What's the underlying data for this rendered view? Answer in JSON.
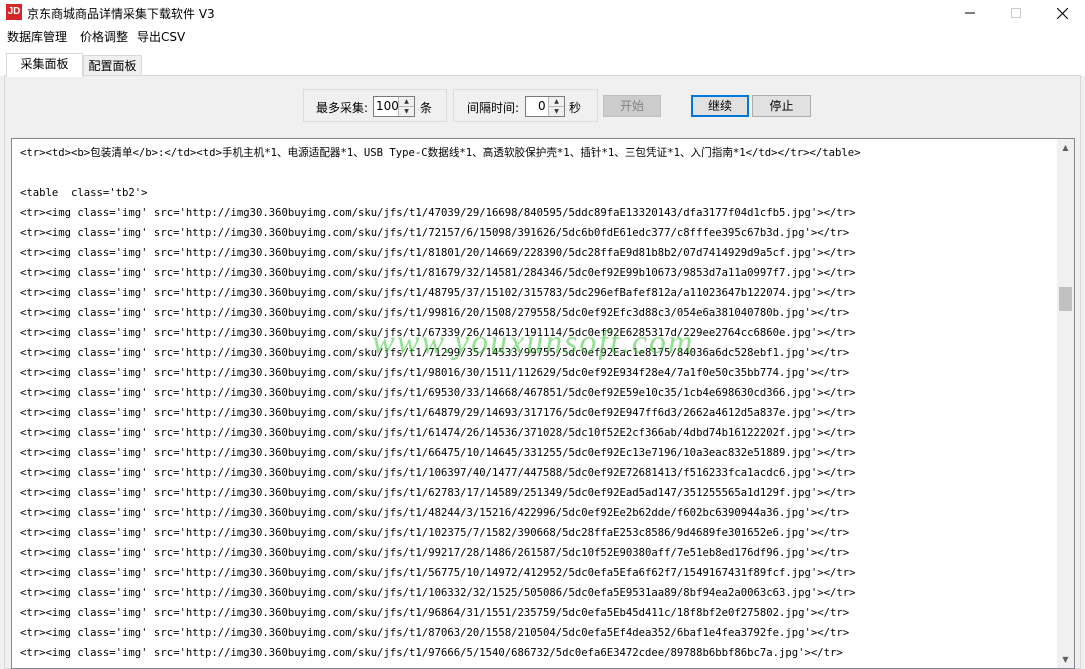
{
  "window": {
    "icon_text": "JD",
    "title": "京东商城商品详情采集下载软件 V3"
  },
  "menu": [
    "数据库管理",
    "价格调整",
    "导出CSV"
  ],
  "tabs": [
    "采集面板",
    "配置面板"
  ],
  "controls": {
    "max_label": "最多采集:",
    "max_value": "100",
    "max_unit": "条",
    "interval_label": "间隔时间:",
    "interval_value": "0",
    "interval_unit": "秒",
    "start_label": "开始",
    "continue_label": "继续",
    "stop_label": "停止"
  },
  "watermark": "www.youxunsoft.com",
  "content_lines": [
    "<tr><td><b>包装清单</b>:</td><td>手机主机*1、电源适配器*1、USB Type-C数据线*1、高透软胶保护壳*1、插针*1、三包凭证*1、入门指南*1</td></tr></table>",
    "",
    "<table  class='tb2'>",
    "<tr><img class='img' src='http://img30.360buyimg.com/sku/jfs/t1/47039/29/16698/840595/5ddc89faE13320143/dfa3177f04d1cfb5.jpg'></tr>",
    "<tr><img class='img' src='http://img30.360buyimg.com/sku/jfs/t1/72157/6/15098/391626/5dc6b0fdE61edc377/c8fffee395c67b3d.jpg'></tr>",
    "<tr><img class='img' src='http://img30.360buyimg.com/sku/jfs/t1/81801/20/14669/228390/5dc28ffaE9d81b8b2/07d7414929d9a5cf.jpg'></tr>",
    "<tr><img class='img' src='http://img30.360buyimg.com/sku/jfs/t1/81679/32/14581/284346/5dc0ef92E99b10673/9853d7a11a0997f7.jpg'></tr>",
    "<tr><img class='img' src='http://img30.360buyimg.com/sku/jfs/t1/48795/37/15102/315783/5dc296efBafef812a/a11023647b122074.jpg'></tr>",
    "<tr><img class='img' src='http://img30.360buyimg.com/sku/jfs/t1/99816/20/1508/279558/5dc0ef92Efc3d88c3/054e6a381040780b.jpg'></tr>",
    "<tr><img class='img' src='http://img30.360buyimg.com/sku/jfs/t1/67339/26/14613/191114/5dc0ef92E6285317d/229ee2764cc6860e.jpg'></tr>",
    "<tr><img class='img' src='http://img30.360buyimg.com/sku/jfs/t1/71299/35/14533/99755/5dc0ef92Eac1e8175/84036a6dc528ebf1.jpg'></tr>",
    "<tr><img class='img' src='http://img30.360buyimg.com/sku/jfs/t1/98016/30/1511/112629/5dc0ef92E934f28e4/7a1f0e50c35bb774.jpg'></tr>",
    "<tr><img class='img' src='http://img30.360buyimg.com/sku/jfs/t1/69530/33/14668/467851/5dc0ef92E59e10c35/1cb4e698630cd366.jpg'></tr>",
    "<tr><img class='img' src='http://img30.360buyimg.com/sku/jfs/t1/64879/29/14693/317176/5dc0ef92E947ff6d3/2662a4612d5a837e.jpg'></tr>",
    "<tr><img class='img' src='http://img30.360buyimg.com/sku/jfs/t1/61474/26/14536/371028/5dc10f52E2cf366ab/4dbd74b16122202f.jpg'></tr>",
    "<tr><img class='img' src='http://img30.360buyimg.com/sku/jfs/t1/66475/10/14645/331255/5dc0ef92Ec13e7196/10a3eac832e51889.jpg'></tr>",
    "<tr><img class='img' src='http://img30.360buyimg.com/sku/jfs/t1/106397/40/1477/447588/5dc0ef92E72681413/f516233fca1acdc6.jpg'></tr>",
    "<tr><img class='img' src='http://img30.360buyimg.com/sku/jfs/t1/62783/17/14589/251349/5dc0ef92Ead5ad147/351255565a1d129f.jpg'></tr>",
    "<tr><img class='img' src='http://img30.360buyimg.com/sku/jfs/t1/48244/3/15216/422996/5dc0ef92Ee2b62dde/f602bc6390944a36.jpg'></tr>",
    "<tr><img class='img' src='http://img30.360buyimg.com/sku/jfs/t1/102375/7/1582/390668/5dc28ffaE253c8586/9d4689fe301652e6.jpg'></tr>",
    "<tr><img class='img' src='http://img30.360buyimg.com/sku/jfs/t1/99217/28/1486/261587/5dc10f52E90380aff/7e51eb8ed176df96.jpg'></tr>",
    "<tr><img class='img' src='http://img30.360buyimg.com/sku/jfs/t1/56775/10/14972/412952/5dc0efa5Efa6f62f7/1549167431f89fcf.jpg'></tr>",
    "<tr><img class='img' src='http://img30.360buyimg.com/sku/jfs/t1/106332/32/1525/505086/5dc0efa5E9531aa89/8bf94ea2a0063c63.jpg'></tr>",
    "<tr><img class='img' src='http://img30.360buyimg.com/sku/jfs/t1/96864/31/1551/235759/5dc0efa5Eb45d411c/18f8bf2e0f275802.jpg'></tr>",
    "<tr><img class='img' src='http://img30.360buyimg.com/sku/jfs/t1/87063/20/1558/210504/5dc0efa5Ef4dea352/6baf1e4fea3792fe.jpg'></tr>",
    "<tr><img class='img' src='http://img30.360buyimg.com/sku/jfs/t1/97666/5/1540/686732/5dc0efa6E3472cdee/89788b6bbf86bc7a.jpg'></tr>"
  ]
}
